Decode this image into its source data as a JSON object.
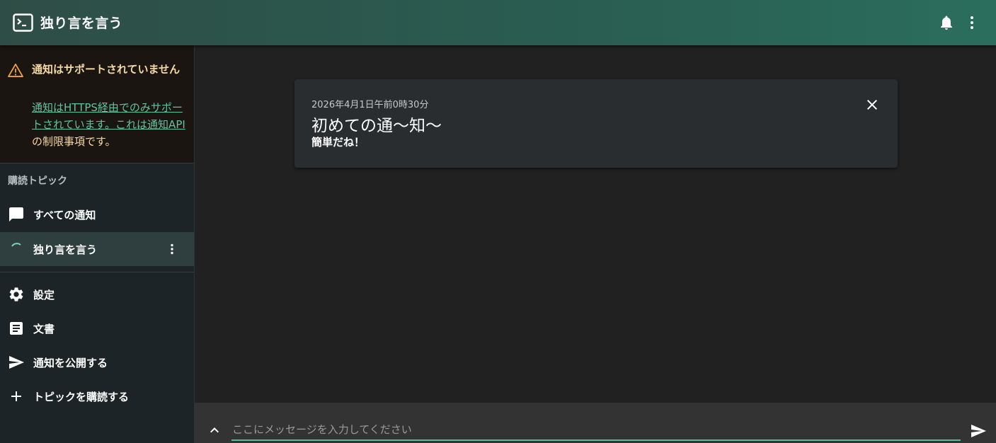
{
  "app": {
    "title": "独り言を言う"
  },
  "alert": {
    "title": "通知はサポートされていません",
    "body_link": "通知はHTTPS経由でのみサポートされています。これは通知API",
    "body_suffix": "の制限事項です。"
  },
  "sidebar": {
    "section_header": "購読トピック",
    "items": [
      {
        "label": "すべての通知",
        "icon": "chat-icon"
      },
      {
        "label": "独り言を言う",
        "icon": "loading-spinner-icon",
        "selected": true
      }
    ],
    "bottom_items": [
      {
        "label": "設定",
        "icon": "gear-icon"
      },
      {
        "label": "文書",
        "icon": "document-icon"
      },
      {
        "label": "通知を公開する",
        "icon": "send-icon"
      },
      {
        "label": "トピックを購読する",
        "icon": "plus-icon"
      }
    ]
  },
  "notification": {
    "date": "2026年4月1日午前0時30分",
    "title": "初めての通～知～",
    "body": "簡単だね！"
  },
  "composer": {
    "placeholder": "ここにメッセージを入力してください"
  },
  "colors": {
    "accent": "#5fb79a",
    "warning_text": "#f7d9a3",
    "link": "#60c3a4",
    "appbar_start": "#2e4d46",
    "appbar_end": "#2b6e5d"
  }
}
